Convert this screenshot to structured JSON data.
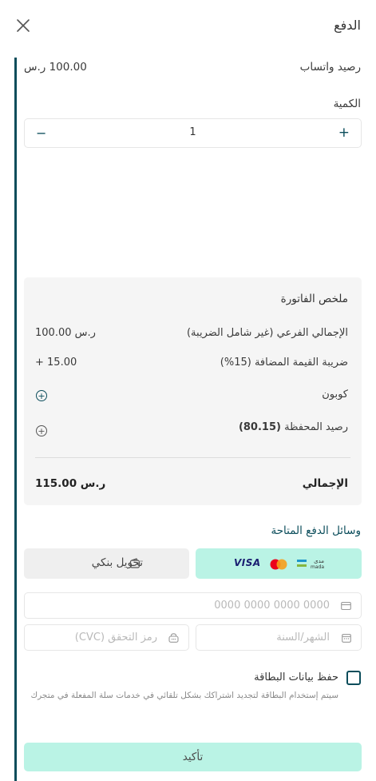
{
  "header": {
    "title": "الدفع"
  },
  "balance": {
    "label": "رصيد واتساب",
    "value": "100.00 ر.س"
  },
  "quantity": {
    "label": "الكمية",
    "value": "1",
    "minus": "−",
    "plus": "+"
  },
  "summary": {
    "title": "ملخص الفاتورة",
    "rows": [
      {
        "label": "الإجمالي الفرعي (غير شامل الضريبة)",
        "value": "100.00 ر.س"
      },
      {
        "label": "ضريبة القيمة المضافة (15%)",
        "value": "+ 15.00"
      },
      {
        "label": "كوبون"
      },
      {
        "label": "رصيد المحفظة",
        "amount": "(80.15)"
      }
    ],
    "total_label": "الإجمالي",
    "total_value": "115.00 ر.س"
  },
  "payment_methods": {
    "title": "وسائل الدفع المتاحة",
    "card_brands": [
      "mada",
      "mastercard",
      "VISA"
    ],
    "mada_text_top": "مدى",
    "mada_text_bottom": "mada",
    "visa_text": "VISA",
    "bank_transfer_label": "تحويل بنكي"
  },
  "card_form": {
    "card_number_placeholder": "0000 0000 0000 0000",
    "expiry_placeholder": "الشهر/السنة",
    "cvc_placeholder": "رمز التحقق (CVC)"
  },
  "save_card": {
    "label": "حفظ بيانات البطاقة",
    "description": "سيتم إستخدام البطاقة لتجديد اشتراكك بشكل تلقائي في خدمات سلة المفعلة في متجرك",
    "checked": false
  },
  "confirm_button": {
    "label": "تأكيد"
  },
  "colors": {
    "accent": "#0b4d5b",
    "mint": "#baf3e5",
    "summary_bg": "#f5f5f5"
  }
}
